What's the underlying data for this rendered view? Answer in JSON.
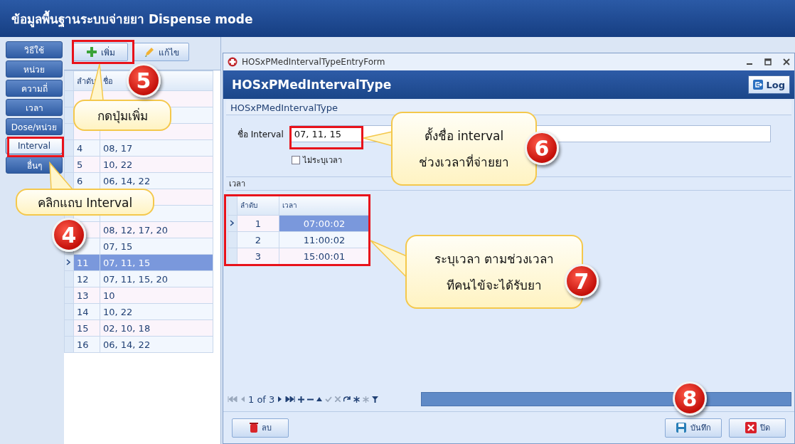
{
  "window": {
    "title": "ข้อมูลพื้นฐานระบบจ่ายยา Dispense mode"
  },
  "nav_tabs": [
    {
      "label": "วิธีใช้",
      "selected": false
    },
    {
      "label": "หน่วย",
      "selected": false
    },
    {
      "label": "ความถี่",
      "selected": false
    },
    {
      "label": "เวลา",
      "selected": false
    },
    {
      "label": "Dose/หน่วย",
      "selected": false
    },
    {
      "label": "Interval",
      "selected": true
    },
    {
      "label": "อื่นๆ",
      "selected": false
    }
  ],
  "toolbar": [
    {
      "label": "เพิ่ม",
      "kind": "add"
    },
    {
      "label": "แก้ไข",
      "kind": "edit"
    }
  ],
  "list_table": {
    "columns": [
      "ลำดับ",
      "ชื่อ"
    ],
    "rows": [
      {
        "selected": false
      },
      {
        "selected": false
      },
      {
        "selected": false
      },
      {
        "number": "4",
        "name": "08, 17",
        "selected": false
      },
      {
        "number": "5",
        "name": "10, 22",
        "selected": false
      },
      {
        "number": "6",
        "name": "06, 14, 22",
        "selected": false
      },
      {
        "selected": false
      },
      {
        "selected": false
      },
      {
        "name": "08, 12, 17, 20",
        "selected": false
      },
      {
        "name": "07, 15",
        "selected": false
      },
      {
        "number": "11",
        "name": "07, 11, 15",
        "selected": true
      },
      {
        "number": "12",
        "name": "07, 11, 15, 20",
        "selected": false
      },
      {
        "number": "13",
        "name": "10",
        "selected": false
      },
      {
        "number": "14",
        "name": "10, 22",
        "selected": false
      },
      {
        "number": "15",
        "name": "02, 10, 18",
        "selected": false
      },
      {
        "number": "16",
        "name": "06, 14, 22",
        "selected": false
      }
    ]
  },
  "dialog": {
    "title": "HOSxPMedIntervalTypeEntryForm",
    "header": "HOSxPMedIntervalType",
    "log_button": "Log",
    "group_title": "HOSxPMedIntervalType",
    "name_label": "ชื่อ Interval",
    "name_value": "07, 11, 15",
    "no_time_checkbox": {
      "label": "ไม่ระบุเวลา",
      "checked": false
    },
    "section_title": "เวลา",
    "time_table": {
      "columns": [
        "ลำดับ",
        "เวลา"
      ],
      "rows": [
        {
          "number": "1",
          "time": "07:00:02",
          "selected": true
        },
        {
          "number": "2",
          "time": "11:00:02",
          "selected": false
        },
        {
          "number": "3",
          "time": "15:00:01",
          "selected": false
        }
      ]
    },
    "navigator": {
      "page": "1 of 3"
    },
    "buttons": [
      {
        "label": "ลบ",
        "kind": "delete"
      },
      {
        "label": "บันทึก",
        "kind": "save"
      },
      {
        "label": "ปิด",
        "kind": "close"
      }
    ]
  },
  "annotations": [
    {
      "kind": "callout",
      "badge": "5",
      "lines": [
        "กดปุ่มเพิ่ม"
      ]
    },
    {
      "kind": "callout",
      "badge": "4",
      "lines": [
        "คลิกแถบ Interval"
      ]
    },
    {
      "kind": "callout",
      "badge": "6",
      "lines": [
        "ตั้งชื่อ interval",
        "ช่วงเวลาที่จ่ายยา"
      ]
    },
    {
      "kind": "callout",
      "badge": "7",
      "lines": [
        "ระบุเวลา ตามช่วงเวลา",
        "ทีคนไข้จะได้รับยา"
      ]
    },
    {
      "kind": "badge",
      "badge": "8"
    }
  ]
}
